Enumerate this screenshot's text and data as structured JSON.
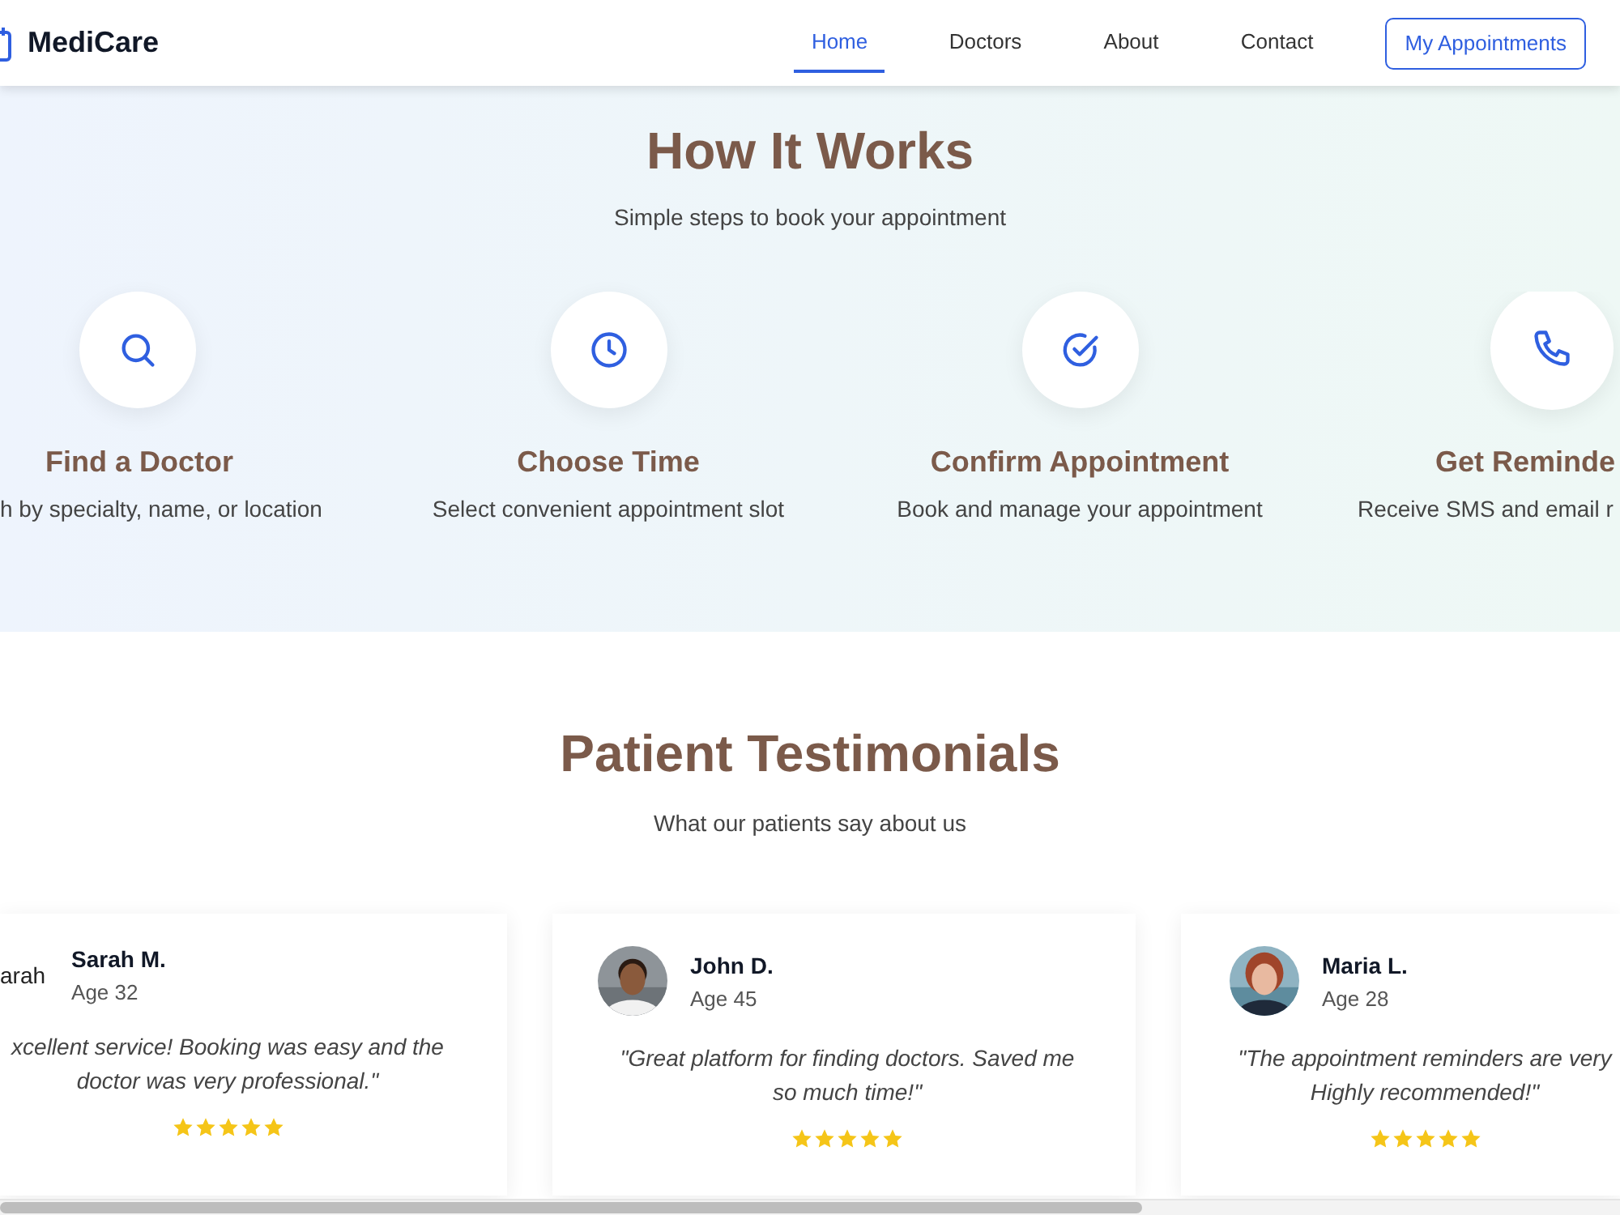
{
  "header": {
    "brand": "MediCare",
    "nav": [
      {
        "label": "Home",
        "selected": true
      },
      {
        "label": "Doctors",
        "selected": false
      },
      {
        "label": "About",
        "selected": false
      },
      {
        "label": "Contact",
        "selected": false
      }
    ],
    "action": "My Appointments"
  },
  "how_it_works": {
    "title": "How It Works",
    "subtitle": "Simple steps to book your appointment",
    "steps": [
      {
        "kind": "search",
        "title": "Find a Doctor",
        "description": "h by specialty, name, or location"
      },
      {
        "kind": "clock",
        "title": "Choose Time",
        "description": "Select convenient appointment slot"
      },
      {
        "kind": "check",
        "title": "Confirm Appointment",
        "description": "Book and manage your appointment"
      },
      {
        "kind": "phone",
        "title": "Get Reminde",
        "description": "Receive SMS and email r"
      }
    ]
  },
  "testimonials": {
    "title": "Patient Testimonials",
    "subtitle": "What our patients say about us",
    "items": [
      {
        "avatar_alt": "arah",
        "name": "Sarah M.",
        "age": "Age 32",
        "quote": "xcellent service! Booking was easy and the\ndoctor was very professional.\"",
        "stars": 5
      },
      {
        "name": "John D.",
        "age": "Age 45",
        "quote": "\"Great platform for finding doctors. Saved me\nso much time!\"",
        "stars": 5
      },
      {
        "name": "Maria L.",
        "age": "Age 28",
        "quote": "\"The appointment reminders are very\nHighly recommended!\"",
        "stars": 5
      }
    ]
  }
}
